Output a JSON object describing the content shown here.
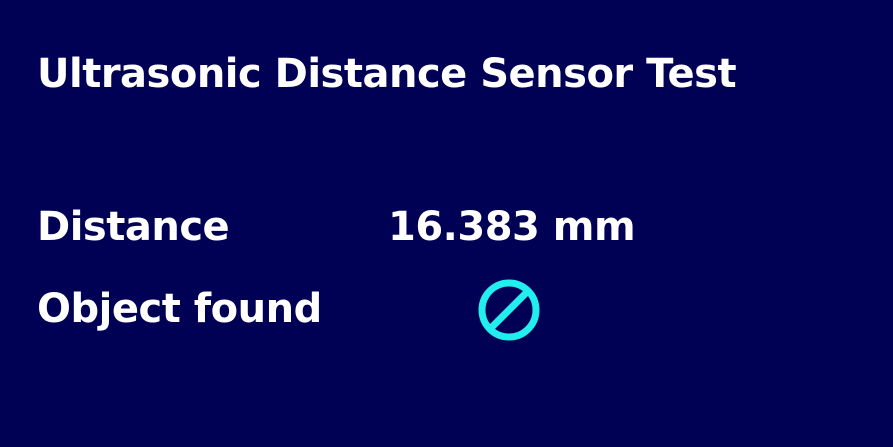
{
  "title": "Ultrasonic Distance Sensor Test",
  "distance": {
    "label": "Distance",
    "value": "16.383 mm"
  },
  "object_found": {
    "label": "Object found",
    "status_icon": "prohibited-icon",
    "icon_color": "#22eeee"
  },
  "colors": {
    "background": "#000055",
    "text": "#ffffff"
  }
}
